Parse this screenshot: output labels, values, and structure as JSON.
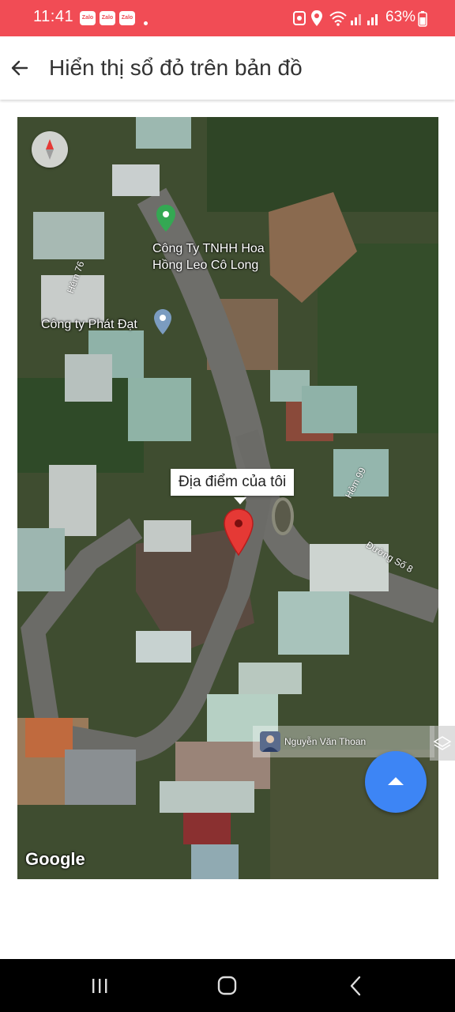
{
  "status_bar": {
    "time": "11:41",
    "notification_icons": [
      "Zalo",
      "Zalo",
      "Zalo"
    ],
    "battery_percent": "63%"
  },
  "app_bar": {
    "title": "Hiển thị sổ đỏ trên bản đồ"
  },
  "map": {
    "pois": [
      {
        "line1": "Công Ty TNHH Hoa",
        "line2": "Hồng Leo Cô Long"
      },
      {
        "line1": "Công ty Phát Đạt"
      }
    ],
    "streets": [
      "Hẻm 76",
      "Hẻm 99",
      "Đường Số 8"
    ],
    "marker_label": "Địa điểm của tôi",
    "attribution": "Google",
    "user_name": "Nguyễn Văn Thoan"
  },
  "colors": {
    "status_bar": "#f14c55",
    "marker": "#e53935",
    "fab": "#3d85f5"
  }
}
